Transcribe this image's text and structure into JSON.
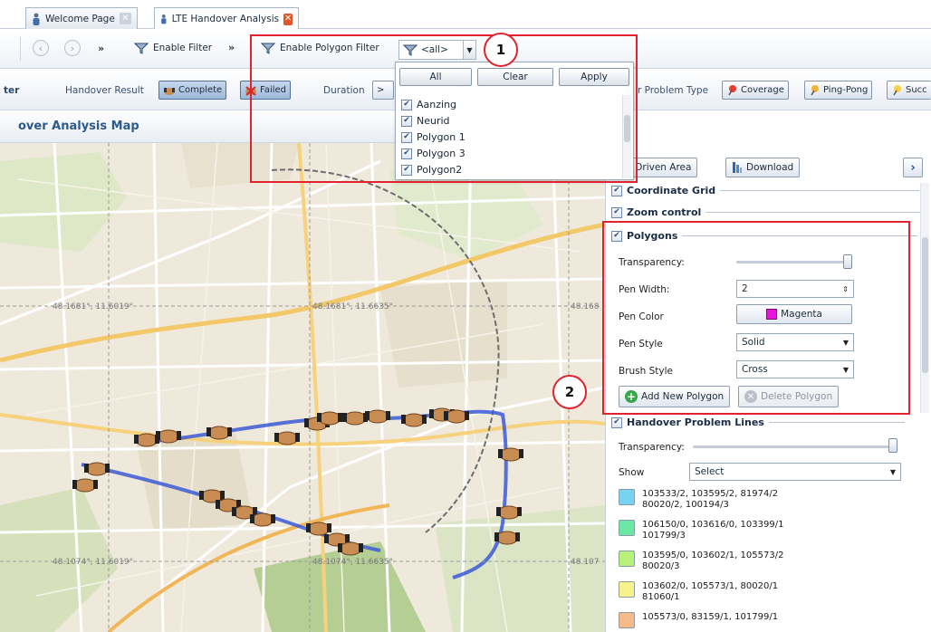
{
  "tabs": [
    {
      "label": "Welcome Page",
      "active": false,
      "close_color": "#c9d2dd"
    },
    {
      "label": "LTE Handover Analysis",
      "active": true,
      "close_color": "#e2542a"
    }
  ],
  "toolbar": {
    "more": "»",
    "enable_filter_label": "Enable Filter",
    "enable_polygon_filter_label": "Enable Polygon Filter",
    "polygon_combo_value": "<all>"
  },
  "filterbar": {
    "left_label": "ter",
    "handover_result_label": "Handover Result",
    "complete_label": "Complete",
    "failed_label": "Failed",
    "duration_label": "Duration",
    "duration_value": ">",
    "problem_type_label": "r Problem Type",
    "coverage_label": "Coverage",
    "pingpong_label": "Ping-Pong",
    "success_label": "Succ"
  },
  "map": {
    "title": "over Analysis Map",
    "grid_labels": [
      "48.1681°, 11.6019°",
      "48.1681°, 11.6635°",
      "48.168",
      "48.1074°, 11.6019°",
      "48.1074°, 11.6635°",
      "48.107"
    ],
    "route_color": "#3b5bd6"
  },
  "popup": {
    "all_label": "All",
    "clear_label": "Clear",
    "apply_label": "Apply",
    "items": [
      "Aanzing",
      "Neurid",
      "Polygon 1",
      "Polygon 3",
      "Polygon2"
    ]
  },
  "panel": {
    "view_driven_area_label": "iew Driven Area",
    "download_label": "Download",
    "expand_icon": "chevron-right-icon",
    "coordinate_grid_label": "Coordinate Grid",
    "zoom_control_label": "Zoom control",
    "polygons_label": "Polygons",
    "transparency_label": "Transparency:",
    "pen_width_label": "Pen Width:",
    "pen_width_value": "2",
    "pen_color_label": "Pen Color",
    "pen_color_value": "Magenta",
    "pen_color_hex": "#e815e0",
    "pen_style_label": "Pen Style",
    "pen_style_value": "Solid",
    "brush_style_label": "Brush Style",
    "brush_style_value": "Cross",
    "add_polygon_label": "Add New Polygon",
    "delete_polygon_label": "Delete Polygon",
    "handover_lines_label": "Handover Problem Lines",
    "show_label": "Show",
    "show_value": "Select",
    "legend": [
      {
        "color": "#78d3f2",
        "line1": "103533/2, 103595/2, 81974/2",
        "line2": "80020/2, 100194/3"
      },
      {
        "color": "#6be7a6",
        "line1": "106150/0, 103616/0, 103399/1",
        "line2": "101799/3"
      },
      {
        "color": "#b8f07c",
        "line1": "103595/0, 103602/1, 105573/2",
        "line2": "80020/3"
      },
      {
        "color": "#f7f38a",
        "line1": "103602/0, 105573/1, 80020/1",
        "line2": "81060/1"
      },
      {
        "color": "#f6b98a",
        "line1": "105573/0, 83159/1, 101799/1",
        "line2": ""
      }
    ]
  },
  "annotations": {
    "callout_1": "1",
    "callout_2": "2",
    "highlight_color": "#e0232e"
  }
}
